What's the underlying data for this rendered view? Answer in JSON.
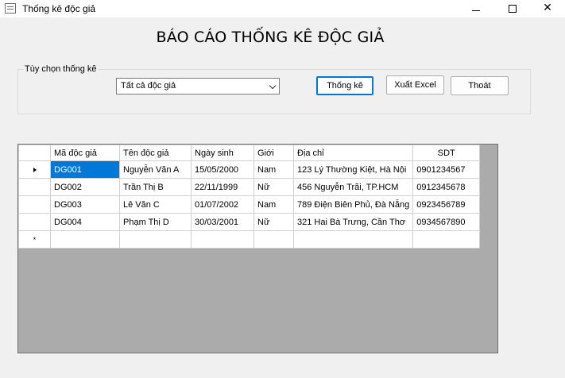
{
  "window": {
    "title": "Thống kê độc giả",
    "icon": "form-icon",
    "controls": {
      "minimize": "—",
      "close": "✕"
    }
  },
  "report_title": "BÁO CÁO THỐNG KÊ ĐỘC GIẢ",
  "options_group": {
    "legend": "Tùy chọn thống kê",
    "filter": {
      "selected": "Tất cả độc giả"
    },
    "buttons": {
      "stats": "Thống kê",
      "export": "Xuất Excel",
      "exit": "Thoát"
    }
  },
  "table": {
    "columns": [
      "Mã độc giả",
      "Tên độc giả",
      "Ngày sinh",
      "Giới",
      "Địa chỉ",
      "SDT"
    ],
    "rows": [
      [
        "DG001",
        "Nguyễn Văn A",
        "15/05/2000",
        "Nam",
        "123 Lý Thường Kiệt, Hà Nội",
        "0901234567"
      ],
      [
        "DG002",
        "Trần Thị B",
        "22/11/1999",
        "Nữ",
        "456 Nguyễn Trãi, TP.HCM",
        "0912345678"
      ],
      [
        "DG003",
        "Lê Văn C",
        "01/07/2002",
        "Nam",
        "789 Điện Biên Phủ, Đà Nẵng",
        "0923456789"
      ],
      [
        "DG004",
        "Phạm Thị D",
        "30/03/2001",
        "Nữ",
        "321 Hai Bà Trưng, Cần Thơ",
        "0934567890"
      ]
    ],
    "new_row_marker": "*",
    "accent_color": "#0078d7"
  }
}
